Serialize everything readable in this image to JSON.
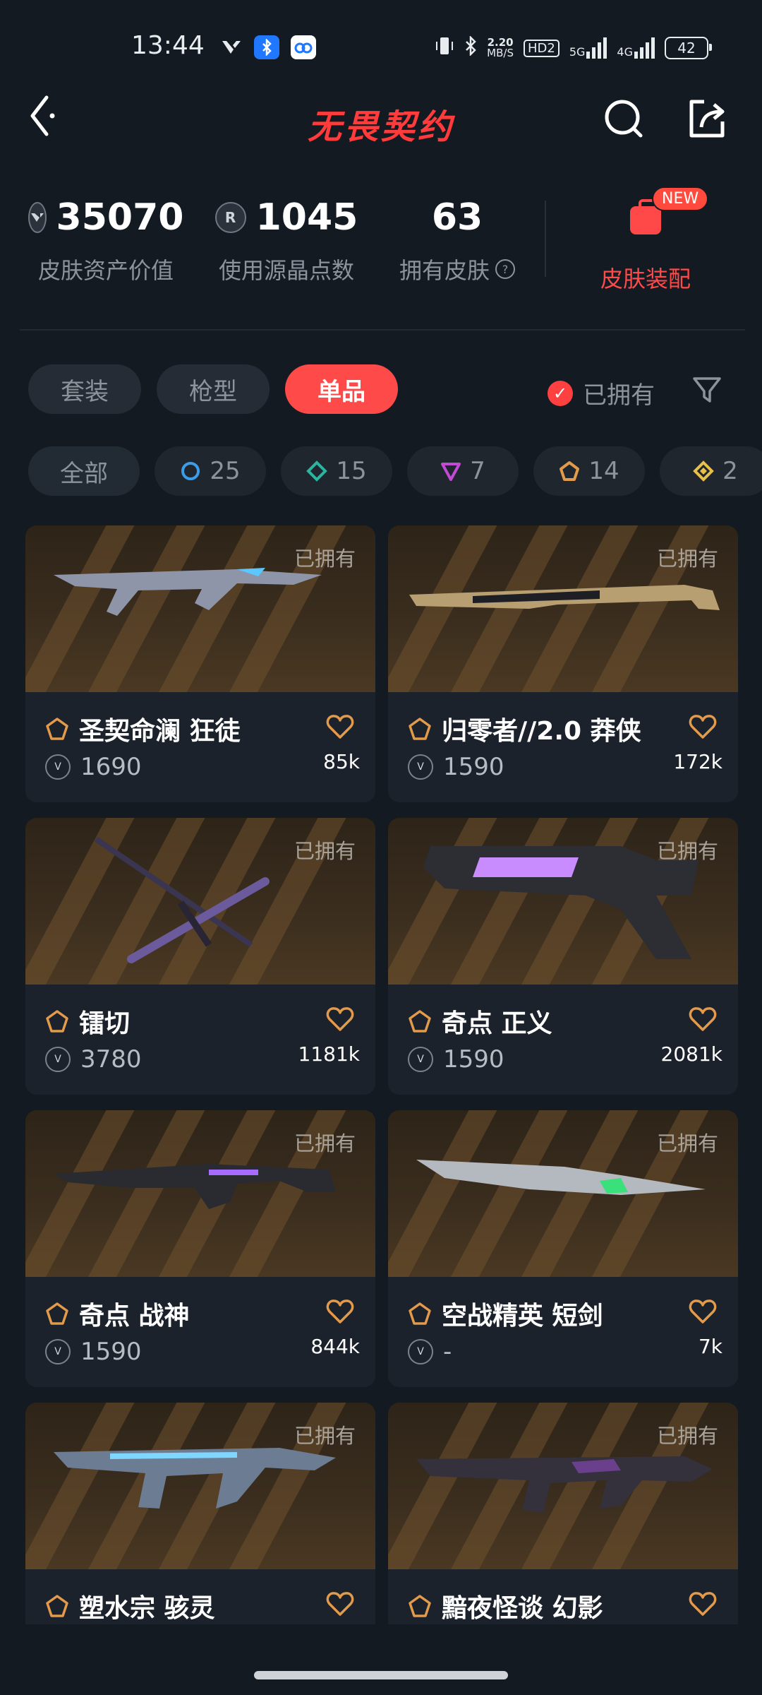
{
  "status_bar": {
    "time": "13:44",
    "net_speed": "2.20",
    "net_unit": "MB/S",
    "hd": "HD2",
    "sig1": "5G",
    "sig2": "4G",
    "battery": "42"
  },
  "header": {
    "title": "无畏契约"
  },
  "stats": [
    {
      "value": "35070",
      "label": "皮肤资产价值",
      "icon": "vp-coin-icon"
    },
    {
      "value": "1045",
      "label": "使用源晶点数",
      "icon": "radianite-icon"
    },
    {
      "value": "63",
      "label": "拥有皮肤",
      "icon": "help-icon"
    }
  ],
  "equip": {
    "label": "皮肤装配",
    "badge": "NEW"
  },
  "tabs": [
    "套装",
    "枪型",
    "单品"
  ],
  "active_tab": "单品",
  "owned_filter": {
    "label": "已拥有",
    "checked": true
  },
  "rarity_chips": [
    {
      "label": "全部"
    },
    {
      "label": "25",
      "color": "#3b9ce8"
    },
    {
      "label": "15",
      "color": "#2bb5a0"
    },
    {
      "label": "7",
      "color": "#c24ad4"
    },
    {
      "label": "14",
      "color": "#e39a4a"
    },
    {
      "label": "2",
      "color": "#e8c04a"
    }
  ],
  "cards": [
    {
      "owned": "已拥有",
      "name": "圣契命澜 狂徒",
      "price": "1690",
      "likes": "85k"
    },
    {
      "owned": "已拥有",
      "name": "归零者//2.0 莽侠",
      "price": "1590",
      "likes": "172k"
    },
    {
      "owned": "已拥有",
      "name": "镭切",
      "price": "3780",
      "likes": "1181k"
    },
    {
      "owned": "已拥有",
      "name": "奇点 正义",
      "price": "1590",
      "likes": "2081k"
    },
    {
      "owned": "已拥有",
      "name": "奇点 战神",
      "price": "1590",
      "likes": "844k"
    },
    {
      "owned": "已拥有",
      "name": "空战精英 短剑",
      "price": "-",
      "likes": "7k"
    },
    {
      "owned": "已拥有",
      "name": "塑水宗 骇灵",
      "price": "",
      "likes": ""
    },
    {
      "owned": "已拥有",
      "name": "黯夜怪谈 幻影",
      "price": "",
      "likes": ""
    }
  ],
  "colors": {
    "accent": "#ff4a4a",
    "background": "#141a22",
    "card": "#1b222b"
  }
}
